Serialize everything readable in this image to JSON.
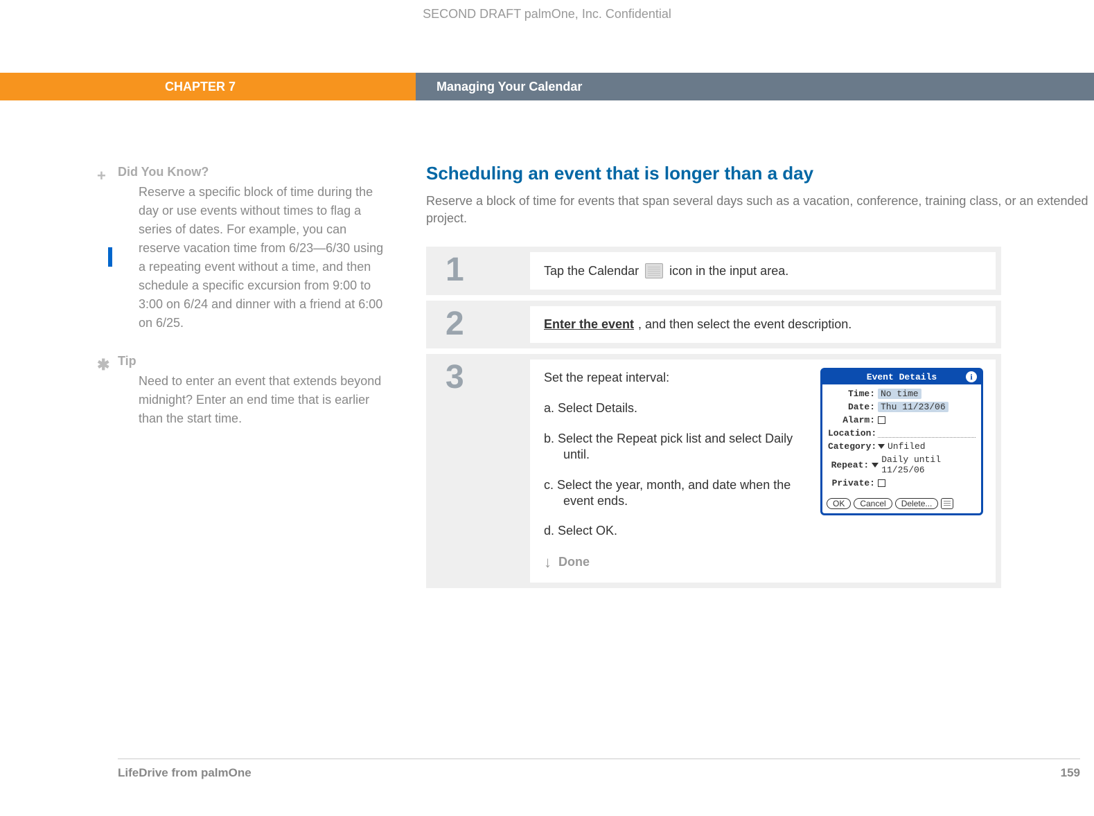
{
  "watermark": "SECOND DRAFT palmOne, Inc.  Confidential",
  "header": {
    "chapter": "CHAPTER 7",
    "title": "Managing Your Calendar"
  },
  "sidebar": {
    "dyk": {
      "title": "Did You Know?",
      "body": "Reserve a specific block of time during the day or use events without times to flag a series of dates. For example, you can reserve vacation time from 6/23—6/30 using a repeating event without a time, and then schedule a specific excursion from 9:00 to 3:00 on 6/24 and dinner with a friend at 6:00 on 6/25."
    },
    "tip": {
      "title": "Tip",
      "body": "Need to enter an event that extends beyond midnight? Enter an end time that is earlier than the start time."
    }
  },
  "main": {
    "title": "Scheduling an event that is longer than a day",
    "intro": "Reserve a block of time for events that span several days such as a vacation, conference, training class, or an extended project."
  },
  "steps": {
    "s1": {
      "num": "1",
      "before": "Tap the Calendar",
      "after": "icon in the input area."
    },
    "s2": {
      "num": "2",
      "link": "Enter the event",
      "after": ", and then select the event description."
    },
    "s3": {
      "num": "3",
      "lead": "Set the repeat interval:",
      "a": "a.  Select Details.",
      "b": "b.  Select the Repeat pick list and select Daily until.",
      "c": "c.  Select the year, month, and date when the event ends.",
      "d": "d.  Select OK.",
      "done": "Done"
    }
  },
  "dialog": {
    "title": "Event Details",
    "time_lbl": "Time:",
    "time_val": "No time",
    "date_lbl": "Date:",
    "date_val": "Thu 11/23/06",
    "alarm_lbl": "Alarm:",
    "loc_lbl": "Location:",
    "cat_lbl": "Category:",
    "cat_val": "Unfiled",
    "rep_lbl": "Repeat:",
    "rep_val": "Daily until 11/25/06",
    "priv_lbl": "Private:",
    "ok": "OK",
    "cancel": "Cancel",
    "delete": "Delete..."
  },
  "footer": {
    "product": "LifeDrive from palmOne",
    "page": "159"
  }
}
